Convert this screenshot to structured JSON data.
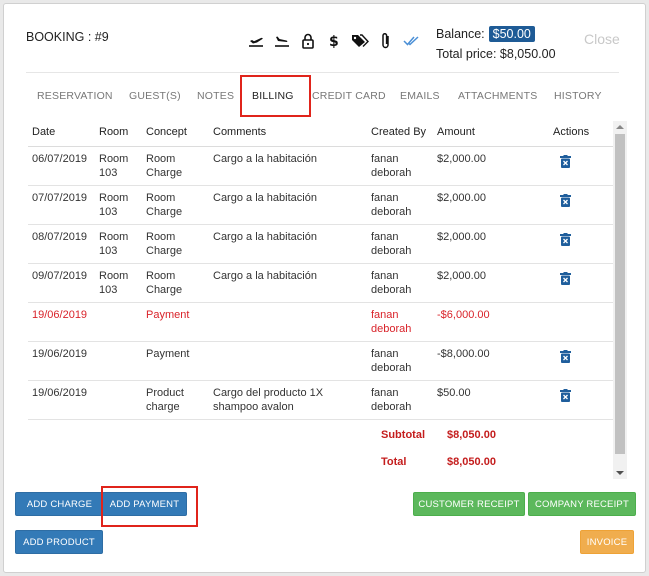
{
  "header": {
    "booking_title": "BOOKING : #9",
    "balance_label": "Balance:",
    "balance_value": "$50.00",
    "total_price": "Total price: $8,050.00",
    "close_label": "Close"
  },
  "header_icons": [
    "plane-departure-icon",
    "plane-arrival-icon",
    "lock-icon",
    "dollar-icon",
    "tags-icon",
    "paperclip-icon",
    "double-check-icon"
  ],
  "tabs": [
    {
      "label": "RESERVATION"
    },
    {
      "label": "GUEST(S)"
    },
    {
      "label": "NOTES"
    },
    {
      "label": "BILLING"
    },
    {
      "label": "CREDIT CARD"
    },
    {
      "label": "EMAILS"
    },
    {
      "label": "ATTACHMENTS"
    },
    {
      "label": "HISTORY"
    }
  ],
  "active_tab": "BILLING",
  "table": {
    "headers": [
      "Date",
      "Room",
      "Concept",
      "Comments",
      "Created By",
      "Amount",
      "Actions"
    ],
    "rows": [
      {
        "date": "06/07/2019",
        "room": "Room 103",
        "concept": "Room Charge",
        "comments": "Cargo a la habitación",
        "created_by": "fanan deborah",
        "amount": "$2,000.00",
        "deletable": true
      },
      {
        "date": "07/07/2019",
        "room": "Room 103",
        "concept": "Room Charge",
        "comments": "Cargo a la habitación",
        "created_by": "fanan deborah",
        "amount": "$2,000.00",
        "deletable": true
      },
      {
        "date": "08/07/2019",
        "room": "Room 103",
        "concept": "Room Charge",
        "comments": "Cargo a la habitación",
        "created_by": "fanan deborah",
        "amount": "$2,000.00",
        "deletable": true
      },
      {
        "date": "09/07/2019",
        "room": "Room 103",
        "concept": "Room Charge",
        "comments": "Cargo a la habitación",
        "created_by": "fanan deborah",
        "amount": "$2,000.00",
        "deletable": true
      },
      {
        "date": "19/06/2019",
        "room": "",
        "concept": "Payment",
        "comments": "",
        "created_by": "fanan deborah",
        "amount": "-$6,000.00",
        "deletable": false,
        "highlight": "red"
      },
      {
        "date": "19/06/2019",
        "room": "",
        "concept": "Payment",
        "comments": "",
        "created_by": "fanan deborah",
        "amount": "-$8,000.00",
        "deletable": true
      },
      {
        "date": "19/06/2019",
        "room": "",
        "concept": "Product charge",
        "comments": "Cargo del producto 1X shampoo avalon",
        "created_by": "fanan deborah",
        "amount": "$50.00",
        "deletable": true
      }
    ],
    "subtotal_label": "Subtotal",
    "subtotal_value": "$8,050.00",
    "total_label": "Total",
    "total_value": "$8,050.00"
  },
  "buttons": {
    "add_charge": "ADD CHARGE",
    "add_payment": "ADD PAYMENT",
    "add_product": "ADD PRODUCT",
    "customer_receipt": "CUSTOMER RECEIPT",
    "company_receipt": "COMPANY RECEIPT",
    "invoice": "INVOICE"
  },
  "colors": {
    "primary": "#337ab7",
    "success": "#5cb85c",
    "warning": "#f0ad4e",
    "danger_text": "#d9232a",
    "highlight_box": "#e0241b",
    "balance_badge": "#1e5b96",
    "trash_icon": "#1f5e9c"
  }
}
